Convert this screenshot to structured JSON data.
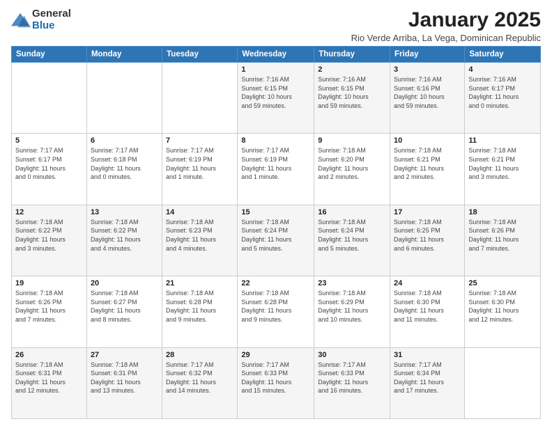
{
  "logo": {
    "general": "General",
    "blue": "Blue"
  },
  "title": "January 2025",
  "subtitle": "Rio Verde Arriba, La Vega, Dominican Republic",
  "days_header": [
    "Sunday",
    "Monday",
    "Tuesday",
    "Wednesday",
    "Thursday",
    "Friday",
    "Saturday"
  ],
  "weeks": [
    [
      {
        "num": "",
        "info": ""
      },
      {
        "num": "",
        "info": ""
      },
      {
        "num": "",
        "info": ""
      },
      {
        "num": "1",
        "info": "Sunrise: 7:16 AM\nSunset: 6:15 PM\nDaylight: 10 hours\nand 59 minutes."
      },
      {
        "num": "2",
        "info": "Sunrise: 7:16 AM\nSunset: 6:15 PM\nDaylight: 10 hours\nand 59 minutes."
      },
      {
        "num": "3",
        "info": "Sunrise: 7:16 AM\nSunset: 6:16 PM\nDaylight: 10 hours\nand 59 minutes."
      },
      {
        "num": "4",
        "info": "Sunrise: 7:16 AM\nSunset: 6:17 PM\nDaylight: 11 hours\nand 0 minutes."
      }
    ],
    [
      {
        "num": "5",
        "info": "Sunrise: 7:17 AM\nSunset: 6:17 PM\nDaylight: 11 hours\nand 0 minutes."
      },
      {
        "num": "6",
        "info": "Sunrise: 7:17 AM\nSunset: 6:18 PM\nDaylight: 11 hours\nand 0 minutes."
      },
      {
        "num": "7",
        "info": "Sunrise: 7:17 AM\nSunset: 6:19 PM\nDaylight: 11 hours\nand 1 minute."
      },
      {
        "num": "8",
        "info": "Sunrise: 7:17 AM\nSunset: 6:19 PM\nDaylight: 11 hours\nand 1 minute."
      },
      {
        "num": "9",
        "info": "Sunrise: 7:18 AM\nSunset: 6:20 PM\nDaylight: 11 hours\nand 2 minutes."
      },
      {
        "num": "10",
        "info": "Sunrise: 7:18 AM\nSunset: 6:21 PM\nDaylight: 11 hours\nand 2 minutes."
      },
      {
        "num": "11",
        "info": "Sunrise: 7:18 AM\nSunset: 6:21 PM\nDaylight: 11 hours\nand 3 minutes."
      }
    ],
    [
      {
        "num": "12",
        "info": "Sunrise: 7:18 AM\nSunset: 6:22 PM\nDaylight: 11 hours\nand 3 minutes."
      },
      {
        "num": "13",
        "info": "Sunrise: 7:18 AM\nSunset: 6:22 PM\nDaylight: 11 hours\nand 4 minutes."
      },
      {
        "num": "14",
        "info": "Sunrise: 7:18 AM\nSunset: 6:23 PM\nDaylight: 11 hours\nand 4 minutes."
      },
      {
        "num": "15",
        "info": "Sunrise: 7:18 AM\nSunset: 6:24 PM\nDaylight: 11 hours\nand 5 minutes."
      },
      {
        "num": "16",
        "info": "Sunrise: 7:18 AM\nSunset: 6:24 PM\nDaylight: 11 hours\nand 5 minutes."
      },
      {
        "num": "17",
        "info": "Sunrise: 7:18 AM\nSunset: 6:25 PM\nDaylight: 11 hours\nand 6 minutes."
      },
      {
        "num": "18",
        "info": "Sunrise: 7:18 AM\nSunset: 6:26 PM\nDaylight: 11 hours\nand 7 minutes."
      }
    ],
    [
      {
        "num": "19",
        "info": "Sunrise: 7:18 AM\nSunset: 6:26 PM\nDaylight: 11 hours\nand 7 minutes."
      },
      {
        "num": "20",
        "info": "Sunrise: 7:18 AM\nSunset: 6:27 PM\nDaylight: 11 hours\nand 8 minutes."
      },
      {
        "num": "21",
        "info": "Sunrise: 7:18 AM\nSunset: 6:28 PM\nDaylight: 11 hours\nand 9 minutes."
      },
      {
        "num": "22",
        "info": "Sunrise: 7:18 AM\nSunset: 6:28 PM\nDaylight: 11 hours\nand 9 minutes."
      },
      {
        "num": "23",
        "info": "Sunrise: 7:18 AM\nSunset: 6:29 PM\nDaylight: 11 hours\nand 10 minutes."
      },
      {
        "num": "24",
        "info": "Sunrise: 7:18 AM\nSunset: 6:30 PM\nDaylight: 11 hours\nand 11 minutes."
      },
      {
        "num": "25",
        "info": "Sunrise: 7:18 AM\nSunset: 6:30 PM\nDaylight: 11 hours\nand 12 minutes."
      }
    ],
    [
      {
        "num": "26",
        "info": "Sunrise: 7:18 AM\nSunset: 6:31 PM\nDaylight: 11 hours\nand 12 minutes."
      },
      {
        "num": "27",
        "info": "Sunrise: 7:18 AM\nSunset: 6:31 PM\nDaylight: 11 hours\nand 13 minutes."
      },
      {
        "num": "28",
        "info": "Sunrise: 7:17 AM\nSunset: 6:32 PM\nDaylight: 11 hours\nand 14 minutes."
      },
      {
        "num": "29",
        "info": "Sunrise: 7:17 AM\nSunset: 6:33 PM\nDaylight: 11 hours\nand 15 minutes."
      },
      {
        "num": "30",
        "info": "Sunrise: 7:17 AM\nSunset: 6:33 PM\nDaylight: 11 hours\nand 16 minutes."
      },
      {
        "num": "31",
        "info": "Sunrise: 7:17 AM\nSunset: 6:34 PM\nDaylight: 11 hours\nand 17 minutes."
      },
      {
        "num": "",
        "info": ""
      }
    ]
  ]
}
